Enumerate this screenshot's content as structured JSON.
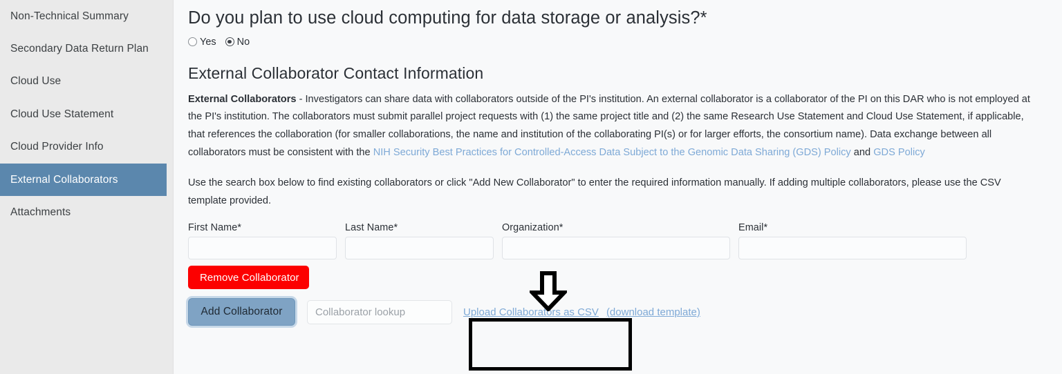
{
  "sidebar": {
    "items": [
      {
        "label": "Non-Technical Summary",
        "active": false
      },
      {
        "label": "Secondary Data Return Plan",
        "active": false
      },
      {
        "label": "Cloud Use",
        "active": false
      },
      {
        "label": "Cloud Use Statement",
        "active": false
      },
      {
        "label": "Cloud Provider Info",
        "active": false
      },
      {
        "label": "External Collaborators",
        "active": true
      },
      {
        "label": "Attachments",
        "active": false
      }
    ]
  },
  "main": {
    "question_title": "Do you plan to use cloud computing for data storage or analysis?*",
    "radio_options": [
      {
        "label": "Yes",
        "selected": false
      },
      {
        "label": "No",
        "selected": true
      }
    ],
    "section_title": "External Collaborator Contact Information",
    "paragraph1": {
      "lead": "External Collaborators",
      "text_before_links": " - Investigators can share data with collaborators outside of the PI's institution. An external collaborator is a collaborator of the PI on this DAR who is not employed at the PI's institution. The collaborators must submit parallel project requests with (1) the same project title and (2) the same Research Use Statement and Cloud Use Statement, if applicable, that references the collaboration (for smaller collaborations, the name and institution of the collaborating PI(s) or for larger efforts, the consortium name). Data exchange between all collaborators must be consistent with the ",
      "link1": "NIH Security Best Practices for Controlled-Access Data Subject to the Genomic Data Sharing (GDS) Policy",
      "conjunction": " and ",
      "link2": "GDS Policy"
    },
    "paragraph2": "Use the search box below to find existing collaborators or click \"Add New Collaborator\" to enter the required information manually. If adding multiple collaborators, please use the CSV template provided.",
    "form": {
      "fields": [
        {
          "label": "First Name*",
          "value": "",
          "placeholder": ""
        },
        {
          "label": "Last Name*",
          "value": "",
          "placeholder": ""
        },
        {
          "label": "Organization*",
          "value": "",
          "placeholder": ""
        },
        {
          "label": "Email*",
          "value": "",
          "placeholder": ""
        }
      ],
      "remove_button": "Remove Collaborator",
      "add_button": "Add Collaborator",
      "lookup_placeholder": "Collaborator lookup",
      "lookup_value": "",
      "upload_csv_link": "Upload Collaborators as CSV",
      "download_template_link": "(download template)"
    }
  },
  "colors": {
    "sidebar_bg": "#eaeaea",
    "sidebar_active_bg": "#5b87ad",
    "main_bg": "#f8f9fa",
    "link_blue": "#7ea9d6",
    "remove_red": "#fc0000",
    "add_blue": "#7fa3c4",
    "annotation_black": "#000000"
  }
}
